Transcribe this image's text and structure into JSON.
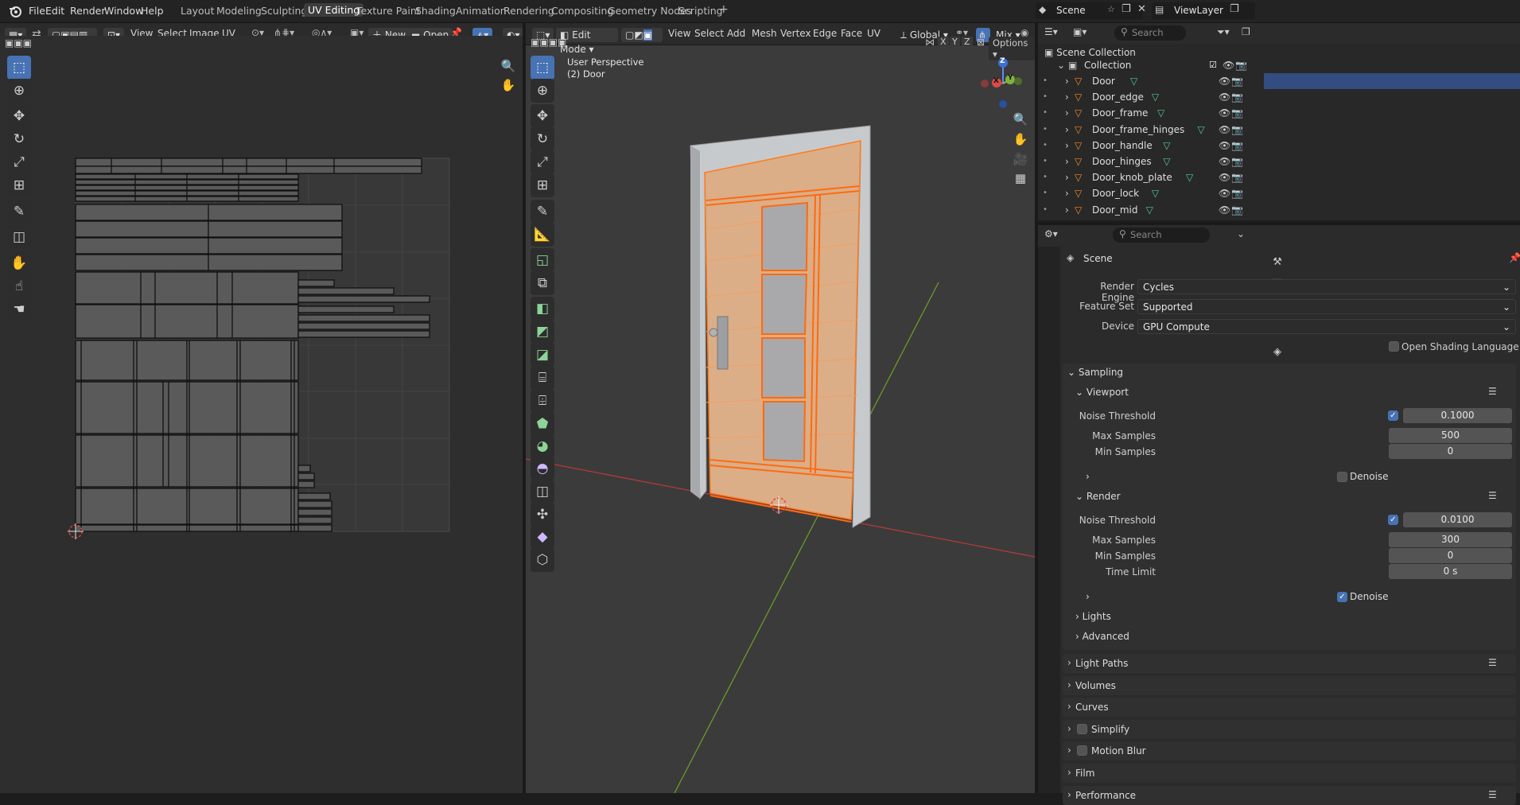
{
  "topbar": {
    "menus": [
      "File",
      "Edit",
      "Render",
      "Window",
      "Help"
    ],
    "workspaces": [
      "Layout",
      "Modeling",
      "Sculpting",
      "UV Editing",
      "Texture Paint",
      "Shading",
      "Animation",
      "Rendering",
      "Compositing",
      "Geometry Nodes",
      "Scripting"
    ],
    "active_workspace": "UV Editing",
    "add_tab": "+",
    "scene_name": "Scene",
    "view_layer": "ViewLayer"
  },
  "uv_editor": {
    "menus": [
      "View",
      "Select",
      "Image",
      "UV"
    ],
    "new_label": "New",
    "open_label": "Open"
  },
  "viewport": {
    "mode": "Edit Mode",
    "menus": [
      "View",
      "Select",
      "Add",
      "Mesh",
      "Vertex",
      "Edge",
      "Face",
      "UV"
    ],
    "orientation": "Global",
    "shading_mode": "Mix",
    "axis_x": "X",
    "axis_y": "Y",
    "axis_z": "Z",
    "options_label": "Options",
    "view_name": "User Perspective",
    "object_info": "(2) Door",
    "gizmo_z": "Z",
    "gizmo_y": "Y",
    "gizmo_x": "X"
  },
  "outliner": {
    "search_placeholder": "Search",
    "scene_collection": "Scene Collection",
    "collection": "Collection",
    "objects": [
      "Door",
      "Door_edge",
      "Door_frame",
      "Door_frame_hinges",
      "Door_handle",
      "Door_hinges",
      "Door_knob_plate",
      "Door_lock",
      "Door_mid"
    ]
  },
  "properties": {
    "search_placeholder": "Search",
    "context": "Scene",
    "render_engine_label": "Render Engine",
    "render_engine": "Cycles",
    "feature_set_label": "Feature Set",
    "feature_set": "Supported",
    "device_label": "Device",
    "device": "GPU Compute",
    "osl_label": "Open Shading Language",
    "sampling": "Sampling",
    "viewport_section": "Viewport",
    "vp_noise_label": "Noise Threshold",
    "vp_noise": "0.1000",
    "vp_max_label": "Max Samples",
    "vp_max": "500",
    "vp_min_label": "Min Samples",
    "vp_min": "0",
    "vp_denoise": "Denoise",
    "render_section": "Render",
    "r_noise_label": "Noise Threshold",
    "r_noise": "0.0100",
    "r_max_label": "Max Samples",
    "r_max": "300",
    "r_min_label": "Min Samples",
    "r_min": "0",
    "r_time_label": "Time Limit",
    "r_time": "0 s",
    "r_denoise": "Denoise",
    "lights": "Lights",
    "advanced": "Advanced",
    "light_paths": "Light Paths",
    "volumes": "Volumes",
    "curves": "Curves",
    "simplify": "Simplify",
    "motion_blur": "Motion Blur",
    "film": "Film",
    "performance": "Performance"
  },
  "colors": {
    "accent": "#4772b3",
    "selection_orange": "#ff7a1a",
    "door_face": "#d9b08c",
    "x_axis": "#b33a3a",
    "y_axis": "#6a9a2a"
  }
}
